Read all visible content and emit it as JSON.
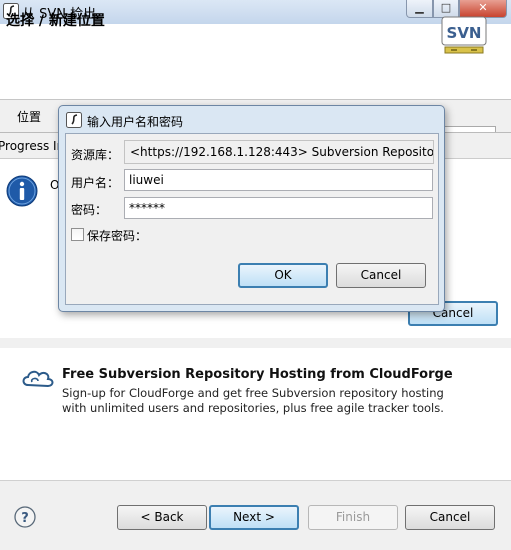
{
  "window": {
    "title": "从 SVN 检出",
    "min_glyph": "▁",
    "max_glyph": "□",
    "close_glyph": "✕"
  },
  "header": {
    "title": "选择 / 新建位置",
    "logo_text": "SVN"
  },
  "location": {
    "label": "位置"
  },
  "progress": {
    "title": "Progress In",
    "message": "O",
    "cancel_label": "Cancel"
  },
  "credentials": {
    "title": "输入用户名和密码",
    "repo_label": "资源库：",
    "repo_value": "<https://192.168.1.128:443> Subversion Repositories",
    "user_label": "用户名：",
    "user_value": "liuwei",
    "pass_label": "密码：",
    "pass_value": "******",
    "save_label": "保存密码：",
    "save_checked": false,
    "ok_label": "OK",
    "cancel_label": "Cancel"
  },
  "promo": {
    "title": "Free Subversion Repository Hosting from CloudForge",
    "line1": "Sign-up for CloudForge and get free Subversion repository hosting",
    "line2": "with unlimited users and repositories, plus free agile tracker tools."
  },
  "buttons": {
    "back": "< Back",
    "next": "Next >",
    "finish": "Finish",
    "cancel": "Cancel"
  },
  "colors": {
    "accent": "#3c7fb1",
    "info_blue": "#1f5aa8",
    "dialog_frame": "#dae7f3"
  }
}
